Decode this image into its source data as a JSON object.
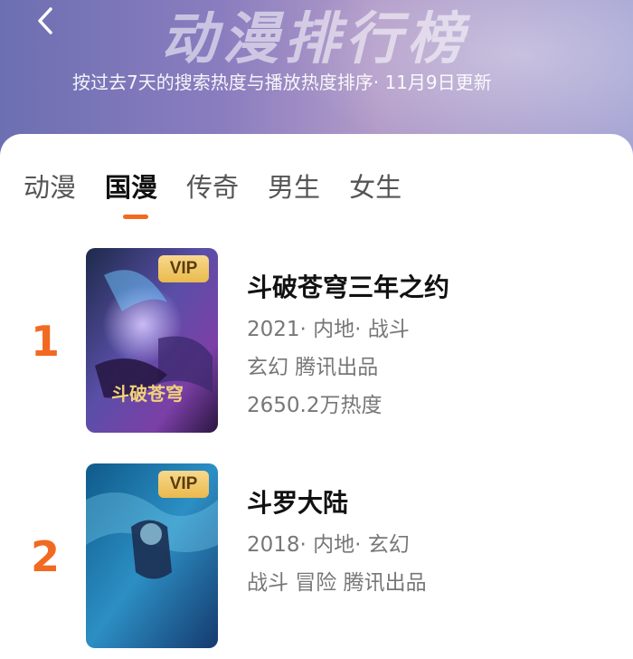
{
  "header": {
    "title": "动漫排行榜",
    "subtitle": "按过去7天的搜索热度与播放热度排序· 11月9日更新"
  },
  "tabs": [
    "动漫",
    "国漫",
    "传奇",
    "男生",
    "女生"
  ],
  "active_tab": "国漫",
  "accent_color": "#f26a21",
  "items": [
    {
      "rank": "1",
      "badge": "VIP",
      "title": "斗破苍穹三年之约",
      "meta1": "2021· 内地· 战斗",
      "meta2": "玄幻 腾讯出品",
      "meta3": "2650.2万热度",
      "poster_text": "斗破苍穹"
    },
    {
      "rank": "2",
      "badge": "VIP",
      "title": "斗罗大陆",
      "meta1": "2018· 内地· 玄幻",
      "meta2": "战斗 冒险 腾讯出品"
    }
  ]
}
